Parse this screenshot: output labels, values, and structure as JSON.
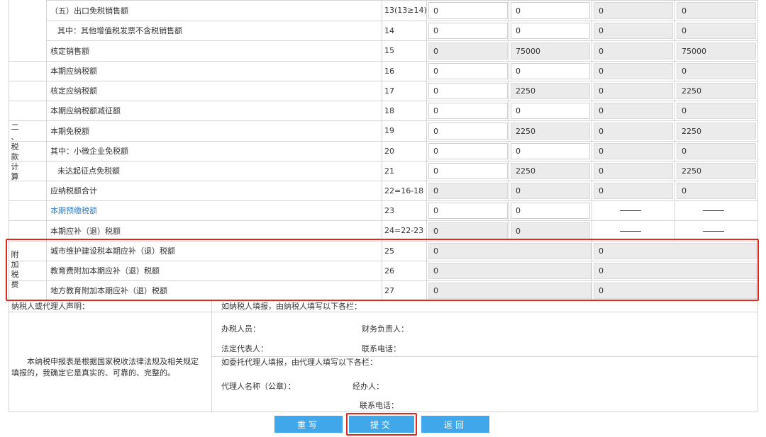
{
  "sections": {
    "tax_calc": [
      "二",
      "、",
      "税",
      "款",
      "计",
      "算"
    ],
    "surcharge": [
      "附",
      "加",
      "税",
      "费"
    ]
  },
  "rows": [
    {
      "label": "（五）出口免税销售额",
      "line": "13(13≥14)",
      "v": [
        "0",
        "0",
        "0",
        "0"
      ]
    },
    {
      "label": "其中：其他增值税发票不含税销售额",
      "line": "14",
      "v": [
        "0",
        "0",
        "0",
        "0"
      ]
    },
    {
      "label": "核定销售额",
      "line": "15",
      "v": [
        "0",
        "75000",
        "0",
        "75000"
      ]
    },
    {
      "label": "本期应纳税额",
      "line": "16",
      "v": [
        "0",
        "0",
        "0",
        "0"
      ]
    },
    {
      "label": "核定应纳税额",
      "line": "17",
      "v": [
        "0",
        "2250",
        "0",
        "2250"
      ]
    },
    {
      "label": "本期应纳税额减征额",
      "line": "18",
      "v": [
        "0",
        "0",
        "0",
        "0"
      ]
    },
    {
      "label": "本期免税额",
      "line": "19",
      "v": [
        "0",
        "2250",
        "0",
        "2250"
      ]
    },
    {
      "label": "其中：小微企业免税额",
      "line": "20",
      "v": [
        "0",
        "0",
        "0",
        "0"
      ]
    },
    {
      "label": "未达起征点免税额",
      "line": "21",
      "v": [
        "0",
        "2250",
        "0",
        "2250"
      ]
    },
    {
      "label": "应纳税额合计",
      "line": "22=16-18",
      "v": [
        "0",
        "0",
        "0",
        "0"
      ]
    },
    {
      "label": "本期预缴税额",
      "line": "23",
      "v": [
        "0",
        "0",
        "——",
        "——"
      ]
    },
    {
      "label": "本期应补（退）税额",
      "line": "24=22-23",
      "v": [
        "0",
        "0",
        "——",
        "——"
      ]
    },
    {
      "label": "城市维护建设税本期应补（退）税额",
      "line": "25",
      "v": [
        "0",
        "0"
      ]
    },
    {
      "label": "教育费附加本期应补（退）税额",
      "line": "26",
      "v": [
        "0",
        "0"
      ]
    },
    {
      "label": "地方教育附加本期应补（退）税额",
      "line": "27",
      "v": [
        "0",
        "0"
      ]
    }
  ],
  "declaration": {
    "heading": "纳税人或代理人声明：",
    "body": "本纳税申报表是根据国家税收法律法规及相关规定填报的，我确定它是真实的、可靠的、完整的。",
    "taxpayer_heading": "如纳税人填报，由纳税人填写以下各栏：",
    "handler": "办税人员：",
    "finance_head": "财务负责人：",
    "legal_rep": "法定代表人：",
    "phone": "联系电话：",
    "agent_heading": "如委托代理人填报，由代理人填写以下各栏：",
    "agent_name": "代理人名称（公章）：",
    "agent_handler": "经办人：",
    "agent_phone": "联系电话："
  },
  "buttons": {
    "reset": "重写",
    "submit": "提交",
    "back": "返回"
  }
}
